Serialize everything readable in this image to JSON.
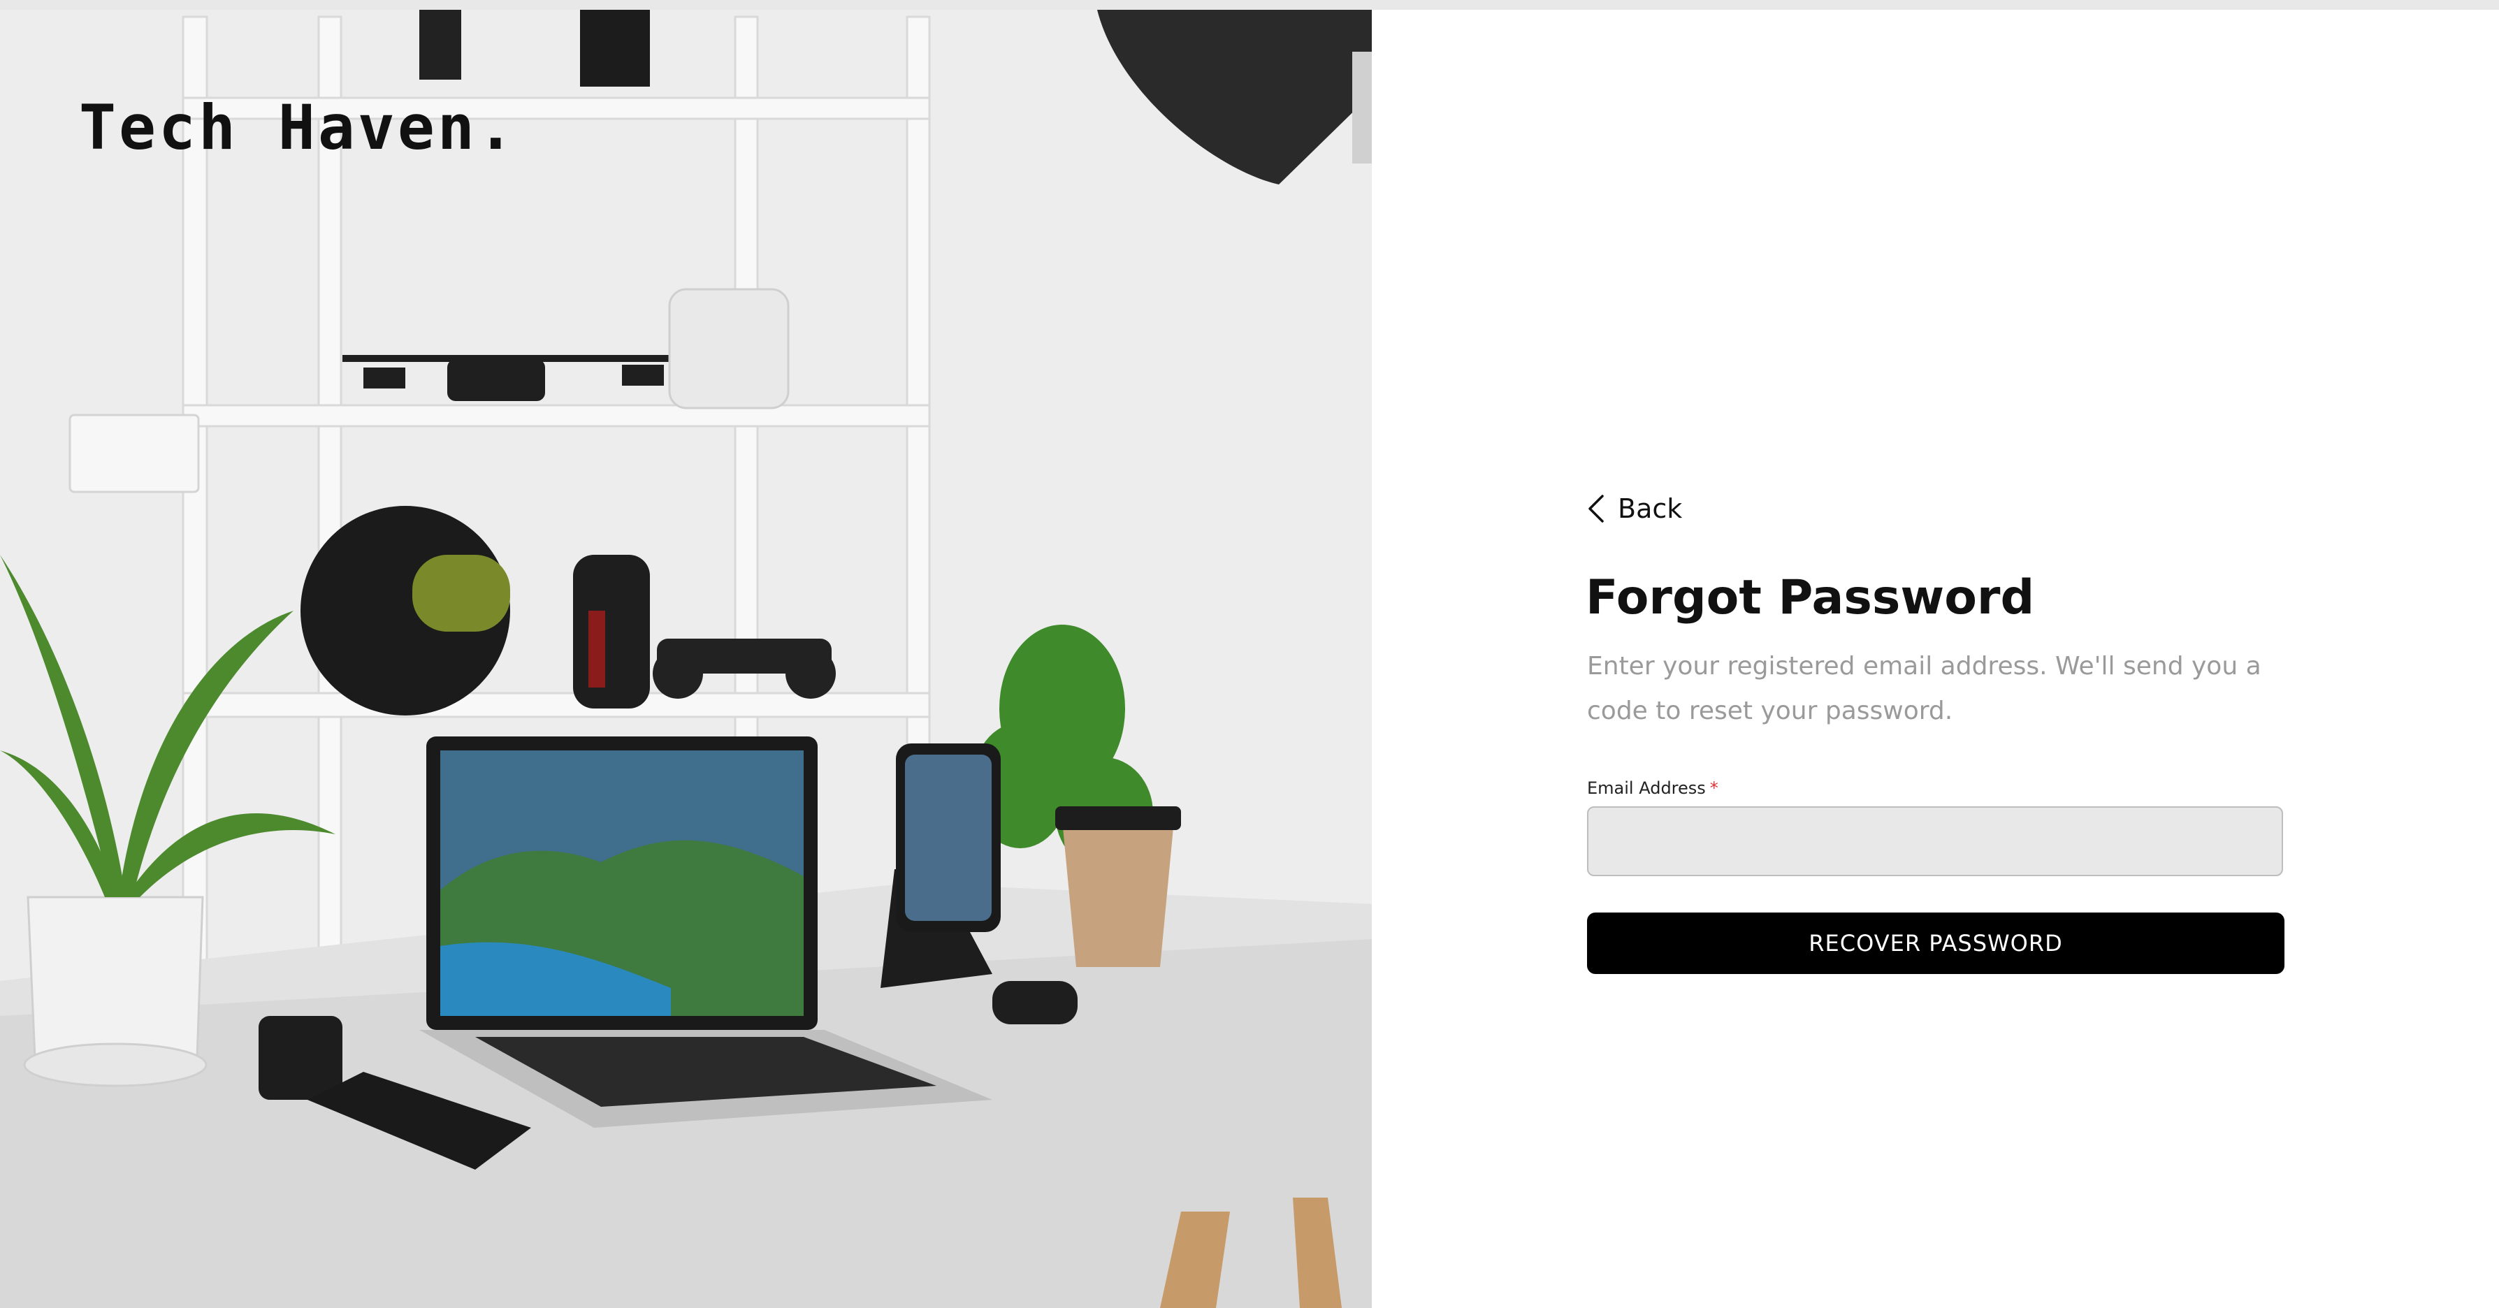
{
  "brand": {
    "logo_text": "Tech Haven."
  },
  "form": {
    "back_label": "Back",
    "title": "Forgot Password",
    "description": "Enter your registered email address. We'll send you a code to reset your password.",
    "email_label": "Email Address",
    "required_marker": "*",
    "email_value": "",
    "email_placeholder": "",
    "submit_label": "RECOVER PASSWORD"
  },
  "icons": {
    "back": "chevron-left-icon"
  },
  "colors": {
    "button_bg": "#000000",
    "button_text": "#ffffff",
    "input_bg": "#e8e8e8",
    "required": "#dd3333",
    "muted_text": "#9a9a9a"
  }
}
